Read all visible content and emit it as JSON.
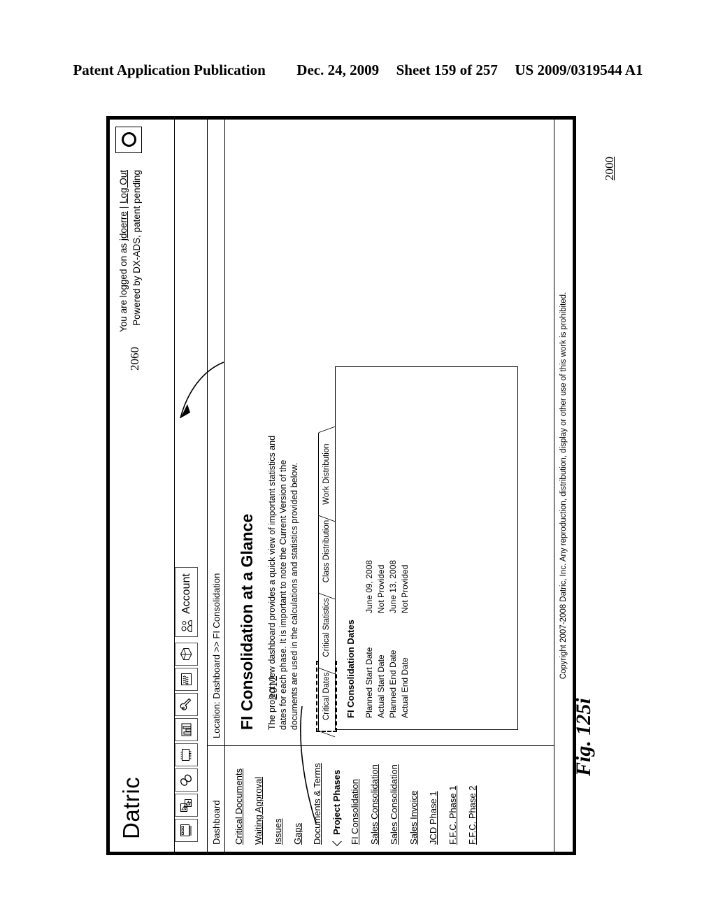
{
  "patent_header": {
    "publication": "Patent Application Publication",
    "date": "Dec. 24, 2009",
    "sheet": "Sheet 159 of 257",
    "number": "US 2009/0319544 A1"
  },
  "figure": {
    "label": "Fig. 125i",
    "ref_main": "2000",
    "ref_content": "2060",
    "ref_sidebar": "2012"
  },
  "app": {
    "brand": "Datric",
    "login_line": "You are logged on as ",
    "login_user": "jdoerre",
    "login_sep": " | ",
    "logout_label": "Log Out",
    "powered_by": "Powered by DX-ADS, patent pending",
    "toolbar": {
      "icons": [
        "document-chip-icon",
        "cursor-select-icon",
        "paperclip-link-icon",
        "chip-icon",
        "bar-chart-icon",
        "wrench-icon",
        "waves-icon",
        "cube-pie-icon"
      ],
      "account_label": "Account",
      "account_icon": "people-icon",
      "circle_button_icon": "ring-icon"
    },
    "nav": {
      "tab_label": "Dashboard",
      "location": "Location: Dashboard >> FI Consolidation"
    },
    "sidebar": {
      "links_top": [
        "Critical Documents",
        "Waiting Approval",
        "Issues",
        "Gaps",
        "Documents & Terms"
      ],
      "group_label": "Project Phases",
      "links_phases": [
        "FI Consolidation",
        "Sales Consolidation",
        "Sales Consolidation",
        "Sales Invoice",
        "JCD Phase 1",
        "F.F.C. Phase 1",
        "F.F.C. Phase 2"
      ]
    },
    "content": {
      "title": "FI Consolidation at a Glance",
      "intro": "The project view dashboard provides a quick view of important statistics and dates for each phase.  It is important to note the Current Version of the documents are used in the calculations and statistics provided below.",
      "tabs": [
        {
          "label": "Critical Dates",
          "selected": true
        },
        {
          "label": "Critical Statistics",
          "selected": false
        },
        {
          "label": "Class Distribution",
          "selected": false
        },
        {
          "label": "Work Distribution",
          "selected": false
        }
      ],
      "panel_title": "FI Consolidation Dates",
      "dates": [
        {
          "key": "Planned Start Date",
          "value": "June 09, 2008"
        },
        {
          "key": "Actual Start Date",
          "value": "Not Provided"
        },
        {
          "key": "Planned End Date",
          "value": "June 13, 2008"
        },
        {
          "key": "Actual End Date",
          "value": "Not Provided"
        }
      ]
    },
    "footer": "Copyright 2007-2008 Datric, Inc.  Any reproduction, distribution, display or other use of this work is prohibited."
  }
}
